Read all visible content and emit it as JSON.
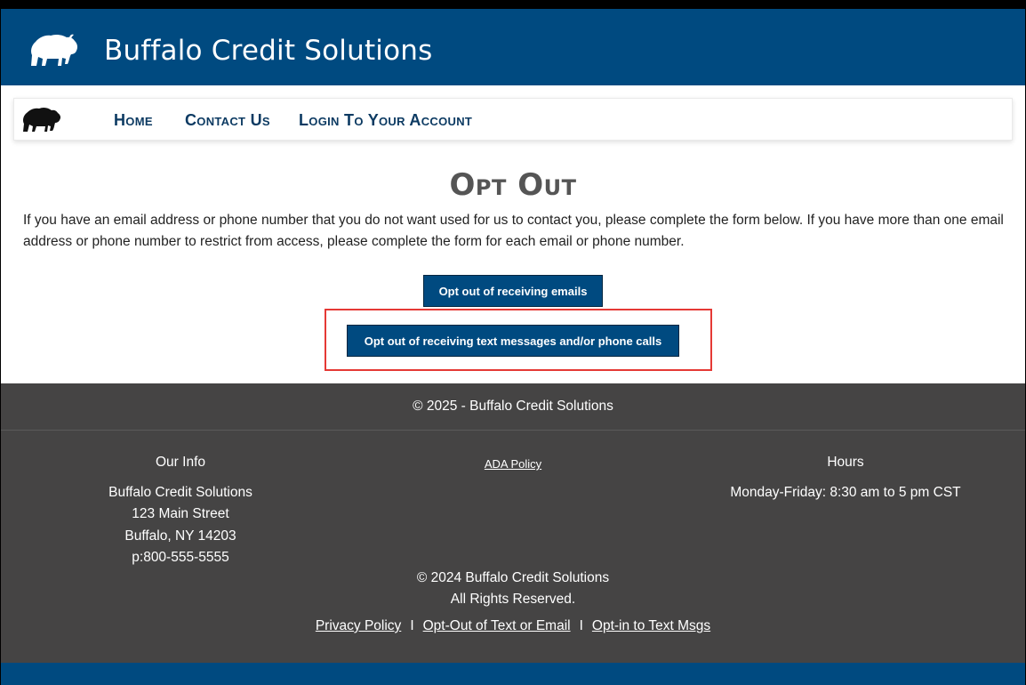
{
  "header": {
    "title": "Buffalo Credit Solutions",
    "logo_icon": "buffalo-icon"
  },
  "nav": {
    "logo_icon": "buffalo-icon",
    "links": [
      "Home",
      "Contact Us",
      "Login To Your Account"
    ]
  },
  "main": {
    "title": "Opt Out",
    "intro": "If you have an email address or phone number that you do not want used for us to contact you, please complete the form below. If you have more than one email address or phone number to restrict from access, please complete the form for each email or phone number.",
    "email_button": "Opt out of receiving emails",
    "text_button": "Opt out of receiving text messages and/or phone calls"
  },
  "footer": {
    "copyright_top": "© 2025 - Buffalo Credit Solutions",
    "info": {
      "heading": "Our Info",
      "company": "Buffalo Credit Solutions",
      "street": "123 Main Street",
      "city": "Buffalo, NY 14203",
      "phone": "p:800-555-5555"
    },
    "ada_link": "ADA Policy",
    "hours": {
      "heading": "Hours",
      "text": "Monday-Friday: 8:30 am to 5 pm CST"
    },
    "copyright_bottom": "© 2024 Buffalo Credit Solutions",
    "rights": "All Rights Reserved.",
    "links": [
      "Privacy Policy",
      "Opt-Out of Text or Email",
      "Opt-in to Text Msgs"
    ],
    "link_separator": "I"
  },
  "colors": {
    "brand_blue": "#004a80",
    "nav_text": "#0c3a62",
    "footer_bg": "#454444",
    "highlight": "#e53935"
  }
}
